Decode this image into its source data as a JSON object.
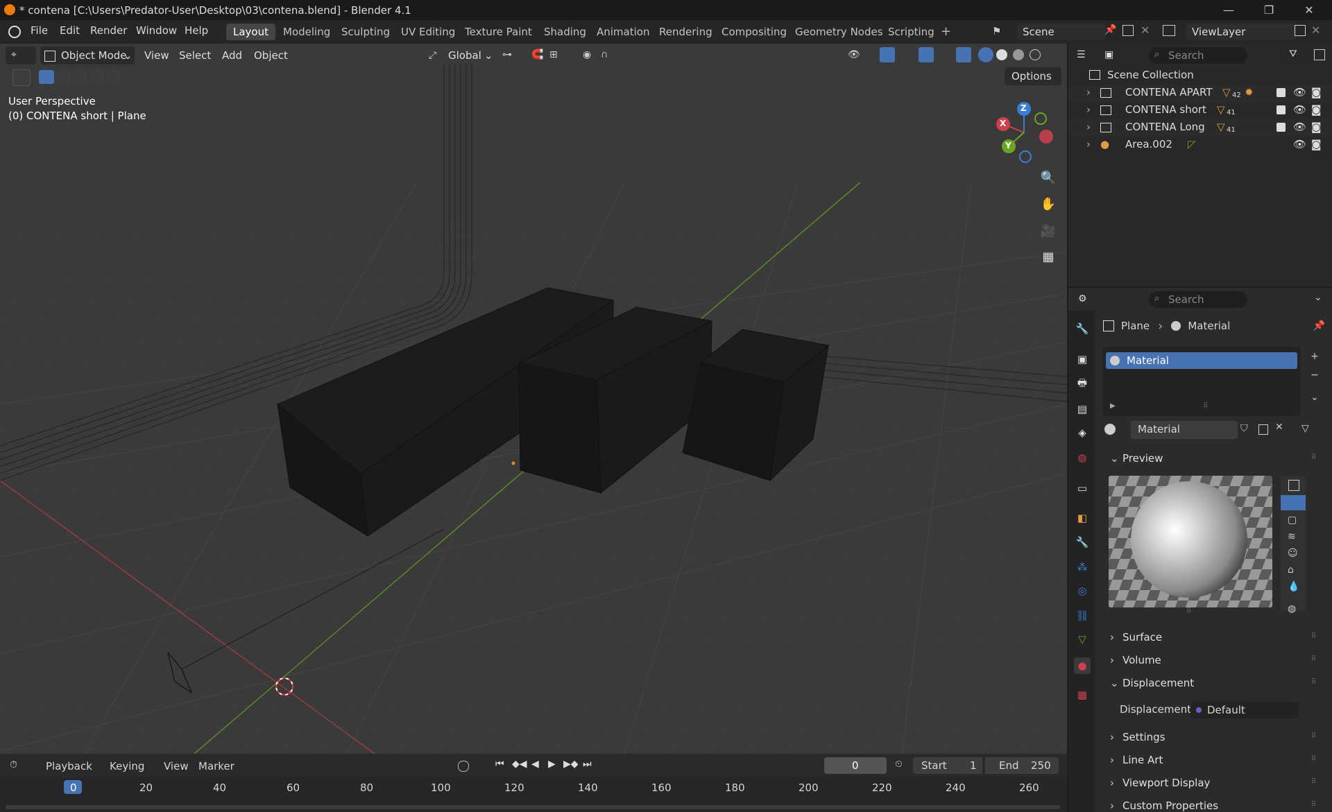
{
  "window": {
    "title": "* contena [C:\\Users\\Predator-User\\Desktop\\03\\contena.blend] - Blender 4.1",
    "controls": [
      "—",
      "❐",
      "✕"
    ]
  },
  "menu": [
    "File",
    "Edit",
    "Render",
    "Window",
    "Help"
  ],
  "workspaces": [
    "Layout",
    "Modeling",
    "Sculpting",
    "UV Editing",
    "Texture Paint",
    "Shading",
    "Animation",
    "Rendering",
    "Compositing",
    "Geometry Nodes",
    "Scripting"
  ],
  "active_workspace": "Layout",
  "scene": {
    "name": "Scene"
  },
  "view_layer": {
    "name": "ViewLayer"
  },
  "viewport": {
    "mode": "Object Mode",
    "menus": [
      "View",
      "Select",
      "Add",
      "Object"
    ],
    "orientation": "Global",
    "options_label": "Options",
    "info_line1": "User Perspective",
    "info_line2": "(0) CONTENA short | Plane",
    "gizmo": {
      "x": "X",
      "y": "Y",
      "z": "Z"
    }
  },
  "timeline": {
    "menus": [
      "Playback",
      "Keying",
      "View",
      "Marker"
    ],
    "current_frame": "0",
    "start_label": "Start",
    "start_value": "1",
    "end_label": "End",
    "end_value": "250",
    "ruler": [
      "0",
      "20",
      "40",
      "60",
      "80",
      "100",
      "120",
      "140",
      "160",
      "180",
      "200",
      "220",
      "240",
      "260"
    ]
  },
  "outliner": {
    "search_placeholder": "Search",
    "root": "Scene Collection",
    "items": [
      {
        "label": "CONTENA APART",
        "badge": "42"
      },
      {
        "label": "CONTENA short",
        "badge": "41"
      },
      {
        "label": "CONTENA Long",
        "badge": "41"
      },
      {
        "label": "Area.002",
        "badge": ""
      }
    ]
  },
  "properties": {
    "search_placeholder": "Search",
    "breadcrumb_object": "Plane",
    "breadcrumb_sep": "›",
    "breadcrumb_material": "Material",
    "slot_name": "Material",
    "material_name": "Material",
    "panels": {
      "preview": "Preview",
      "surface": "Surface",
      "volume": "Volume",
      "displacement": "Displacement",
      "settings": "Settings",
      "line_art": "Line Art",
      "viewport_display": "Viewport Display",
      "custom_properties": "Custom Properties"
    },
    "displacement_label": "Displacement",
    "displacement_value": "Default"
  },
  "colors": {
    "accent": "#4772b3",
    "axis_x": "#cf3f4e",
    "axis_y": "#6ba525",
    "axis_z": "#3a7ed4"
  }
}
